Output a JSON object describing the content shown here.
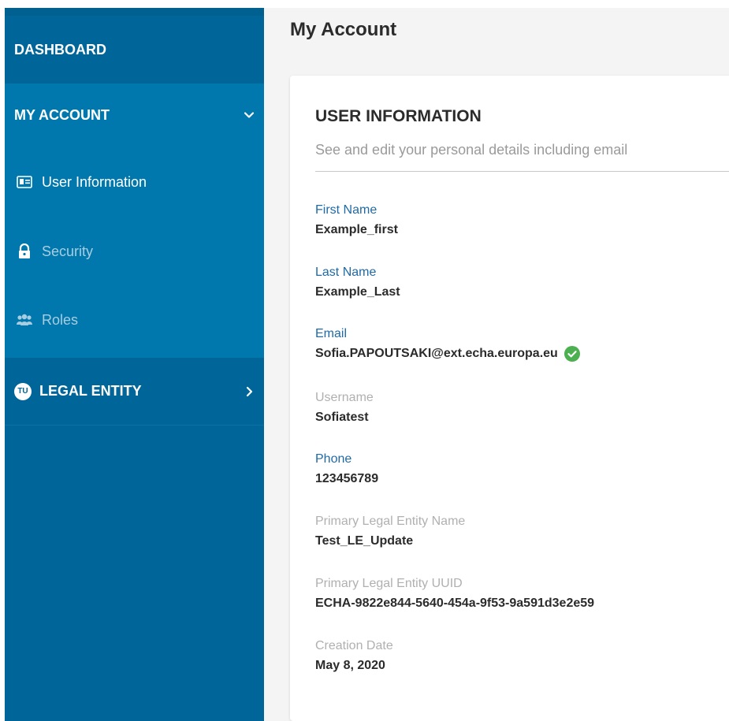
{
  "sidebar": {
    "dashboard": "DASHBOARD",
    "my_account": "MY ACCOUNT",
    "items": [
      {
        "label": "User Information",
        "icon": "id-card-icon",
        "active": true
      },
      {
        "label": "Security",
        "icon": "lock-icon",
        "active": false
      },
      {
        "label": "Roles",
        "icon": "users-icon",
        "active": false
      }
    ],
    "legal_entity": "LEGAL ENTITY",
    "legal_badge": "TU"
  },
  "header": {
    "title": "My Account"
  },
  "card": {
    "title": "USER INFORMATION",
    "subtitle": "See and edit your personal details including email",
    "fields": [
      {
        "label": "First Name",
        "value": "Example_first",
        "editable": true
      },
      {
        "label": "Last Name",
        "value": "Example_Last",
        "editable": true
      },
      {
        "label": "Email",
        "value": "Sofia.PAPOUTSAKI@ext.echa.europa.eu",
        "editable": true,
        "verified": true
      },
      {
        "label": "Username",
        "value": "Sofiatest",
        "editable": false
      },
      {
        "label": "Phone",
        "value": "123456789",
        "editable": true
      },
      {
        "label": "Primary Legal Entity Name",
        "value": "Test_LE_Update",
        "editable": false
      },
      {
        "label": "Primary Legal Entity UUID",
        "value": "ECHA-9822e844-5640-454a-9f53-9a591d3e2e59",
        "editable": false
      },
      {
        "label": "Creation Date",
        "value": "May 8, 2020",
        "editable": false
      }
    ]
  },
  "colors": {
    "sidebar": "#006699",
    "sidebar_expanded": "#0078ad",
    "link_label": "#1f6aa6",
    "muted_label": "#b0b0b0",
    "verified": "#4caf50"
  }
}
